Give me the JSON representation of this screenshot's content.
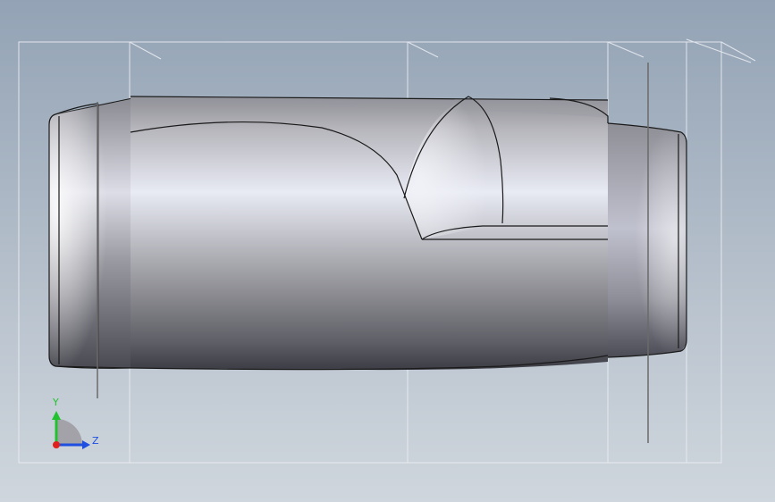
{
  "viewport": {
    "background_top": "#93a3b5",
    "background_bottom": "#cfd6dd",
    "part_color": "#a8a8b0",
    "edge_color": "#1a1a1a",
    "sketch_plane_color": "#e6e9ee"
  },
  "triad": {
    "y_label": "Y",
    "z_label": "Z",
    "y_color": "#22c22e",
    "z_color": "#1f4fe0",
    "x_color": "#e0201c"
  }
}
